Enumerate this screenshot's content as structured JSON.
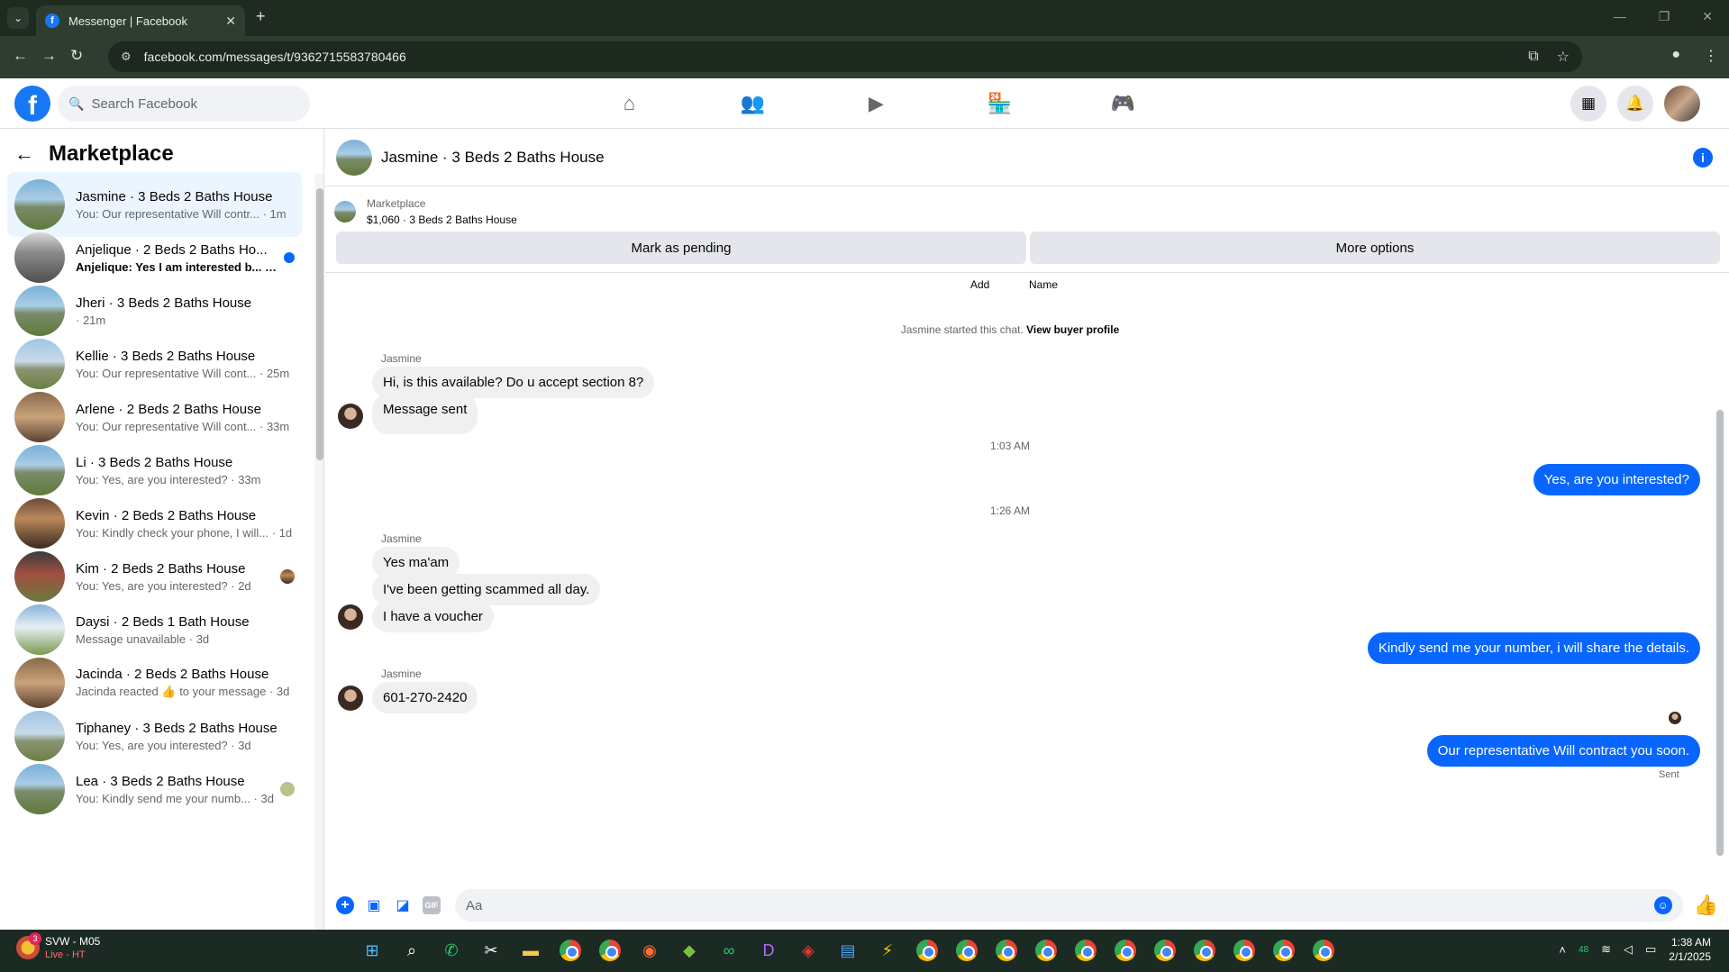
{
  "browser": {
    "tab_title": "Messenger | Facebook",
    "url": "facebook.com/messages/t/9362715583780466",
    "colors": {
      "frame": "#1f2b20",
      "toolbar": "#2f3d30"
    }
  },
  "fb_nav": {
    "search_placeholder": "Search Facebook",
    "icons": [
      "home-icon",
      "friends-icon",
      "watch-icon",
      "marketplace-icon",
      "gaming-icon"
    ],
    "brand_color": "#1877f2"
  },
  "sidebar": {
    "title": "Marketplace",
    "conversations": [
      {
        "name": "Jasmine · 3 Beds 2 Baths House",
        "snippet": "You: Our representative Will contr... · 1m",
        "active": true
      },
      {
        "name": "Anjelique · 2 Beds 2 Baths Ho...",
        "snippet": "Anjelique: Yes I am interested b... 5m",
        "unread": true
      },
      {
        "name": "Jheri · 3 Beds 2 Baths House",
        "snippet": "· 21m"
      },
      {
        "name": "Kellie · 3 Beds 2 Baths House",
        "snippet": "You: Our representative Will cont... · 25m"
      },
      {
        "name": "Arlene · 2 Beds 2 Baths House",
        "snippet": "You: Our representative Will cont... · 33m"
      },
      {
        "name": "Li · 3 Beds 2 Baths House",
        "snippet": "You: Yes, are you interested? · 33m"
      },
      {
        "name": "Kevin · 2 Beds 2 Baths House",
        "snippet": "You: Kindly check your phone, I will... · 1d"
      },
      {
        "name": "Kim · 2 Beds 2 Baths House",
        "snippet": "You: Yes, are you interested? · 2d"
      },
      {
        "name": "Daysi · 2 Beds 1 Bath House",
        "snippet": "Message unavailable · 3d"
      },
      {
        "name": "Jacinda · 2 Beds 2 Baths House",
        "snippet": "Jacinda reacted 👍 to your message · 3d"
      },
      {
        "name": "Tiphaney · 3 Beds 2 Baths House",
        "snippet": "You: Yes, are you interested? · 3d"
      },
      {
        "name": "Lea · 3 Beds 2 Baths House",
        "snippet": "You: Kindly send me your numb... · 3d"
      }
    ]
  },
  "chat": {
    "title": "Jasmine · 3 Beds 2 Baths House",
    "marketplace_label": "Marketplace",
    "listing": "$1,060 · 3 Beds 2 Baths House",
    "mark_pending": "Mark as pending",
    "more_options": "More options",
    "add_label": "Add",
    "name_label": "Name",
    "started_text": "Jasmine started this chat.",
    "buyer_profile": "View buyer profile",
    "sender_name": "Jasmine",
    "messages": {
      "m1": "Hi, is this available? Do u accept section 8?",
      "m2": "Message sent",
      "time1": "1:03 AM",
      "m3": "Yes, are you interested?",
      "time2": "1:26 AM",
      "m4": "Yes ma'am",
      "m5": "I've been getting scammed all day.",
      "m6": "I have a voucher",
      "m7": "Kindly send me your number, i will share the details.",
      "m8": "601-270-2420",
      "m9": "Our representative Will contract you soon.",
      "status": "Sent"
    },
    "composer_placeholder": "Aa",
    "bubble_out_color": "#0866ff",
    "bubble_in_color": "#f0f0f0"
  },
  "taskbar": {
    "weather_line1": "SVW - M05",
    "weather_line2": "Live - HT",
    "badge": "3",
    "time": "1:38 AM",
    "date": "2/1/2025",
    "battery_label": "48"
  }
}
